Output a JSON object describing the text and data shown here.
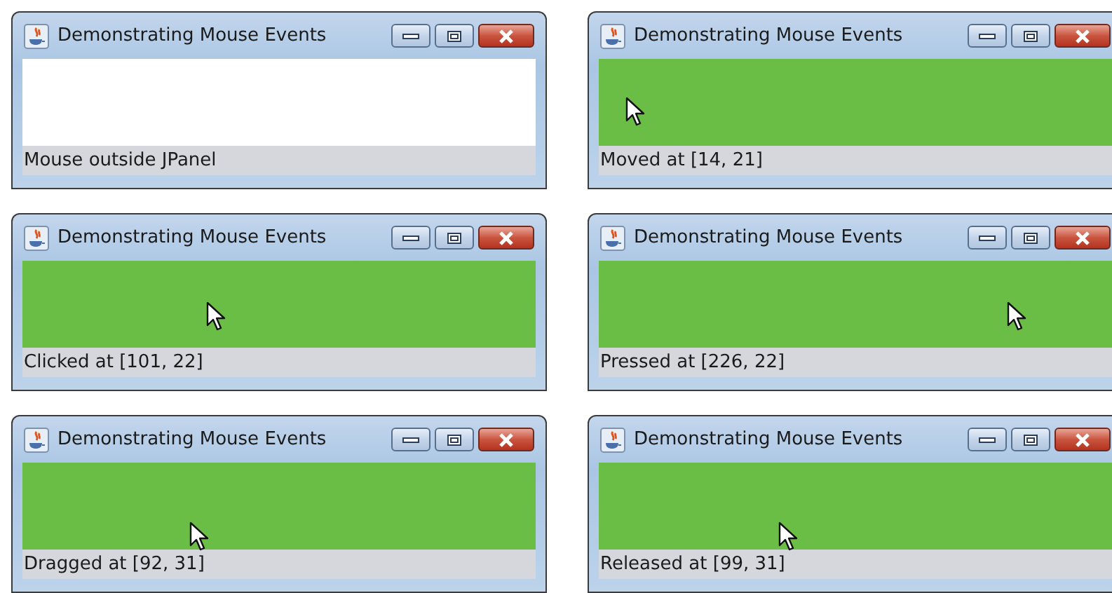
{
  "windows": [
    {
      "title": "Demonstrating Mouse Events",
      "panel_highlighted": false,
      "cursor_shown": false,
      "status": "Mouse outside JPanel"
    },
    {
      "title": "Demonstrating Mouse Events",
      "panel_highlighted": true,
      "cursor_shown": true,
      "status": "Moved at [14, 21]"
    },
    {
      "title": "Demonstrating Mouse Events",
      "panel_highlighted": true,
      "cursor_shown": true,
      "status": "Clicked at [101, 22]"
    },
    {
      "title": "Demonstrating Mouse Events",
      "panel_highlighted": true,
      "cursor_shown": true,
      "status": "Pressed at [226, 22]"
    },
    {
      "title": "Demonstrating Mouse Events",
      "panel_highlighted": true,
      "cursor_shown": true,
      "status": "Dragged at [92, 31]"
    },
    {
      "title": "Demonstrating Mouse Events",
      "panel_highlighted": true,
      "cursor_shown": true,
      "status": "Released at [99, 31]"
    }
  ]
}
